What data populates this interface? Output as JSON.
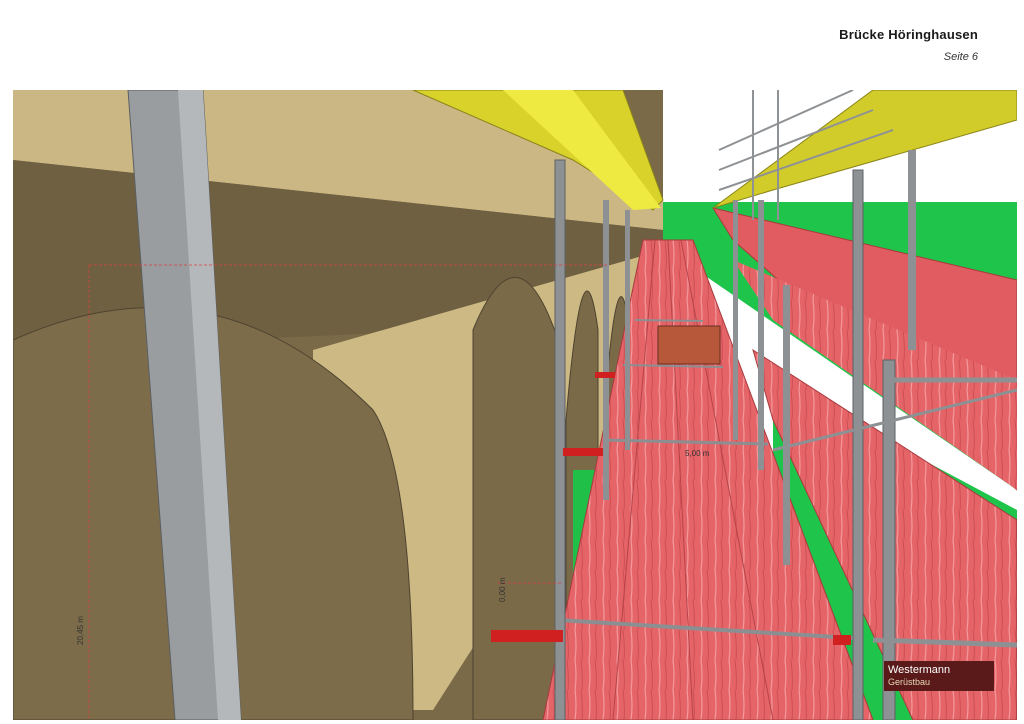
{
  "header": {
    "title": "Brücke Höringhausen",
    "page": "Seite 6"
  },
  "scene": {
    "dimension_height": "20,45 m",
    "dimension_span": "5,00 m",
    "dimension_gap": "0,00 m",
    "colors": {
      "wall": "#8a7a57",
      "wall_light": "#cdb983",
      "deck": "#e0555a",
      "beam": "#d9d22a",
      "grass": "#1fc44a",
      "steel": "#9da0a3"
    }
  },
  "logo": {
    "line1": "Westermann",
    "line2": "Gerüstbau"
  }
}
